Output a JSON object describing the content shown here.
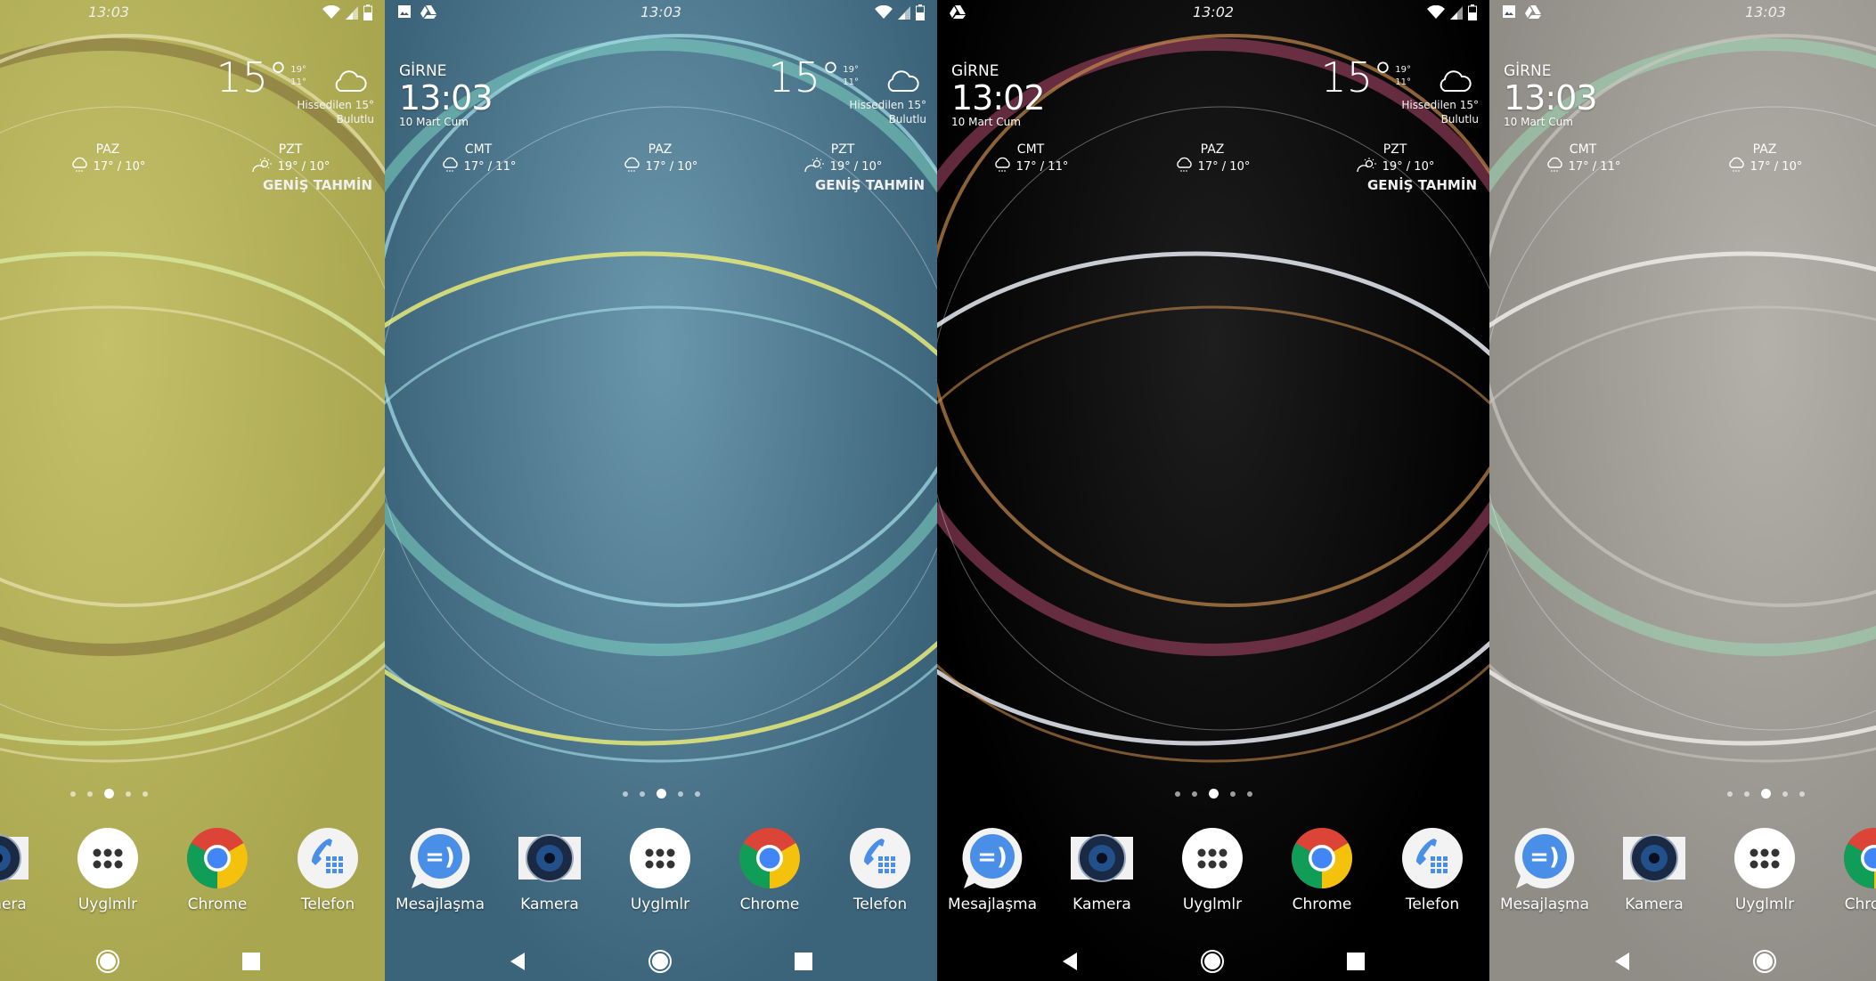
{
  "panels": [
    {
      "theme": {
        "bg1": "#a9a650",
        "bg2": "#c4c06a",
        "arc1": "#7d6a3a",
        "arc2": "#d6e59a",
        "arc3": "#e8e2b0"
      },
      "status_time": "13:03",
      "left_icons": [],
      "right_status": true,
      "clock": null,
      "active_page": 2
    },
    {
      "theme": {
        "bg1": "#3b6379",
        "bg2": "#6b97ad",
        "arc1": "#7fd6c4",
        "arc2": "#e8ea7a",
        "arc3": "#a6e3ea"
      },
      "status_time": "13:03",
      "left_icons": [
        "image-icon",
        "drive-icon"
      ],
      "right_status": true,
      "clock": {
        "city": "GİRNE",
        "time": "13:03",
        "date": "10 Mart Cum"
      },
      "active_page": 2
    },
    {
      "theme": {
        "bg1": "#000000",
        "bg2": "#1e1e1e",
        "arc1": "#b34a6d",
        "arc2": "#e8eef5",
        "arc3": "#c58a4a"
      },
      "status_time": "13:02",
      "left_icons": [
        "drive-icon"
      ],
      "right_status": true,
      "clock": {
        "city": "GİRNE",
        "time": "13:02",
        "date": "10 Mart Cum"
      },
      "active_page": 2
    },
    {
      "theme": {
        "bg1": "#8f8d86",
        "bg2": "#b3b1a9",
        "arc1": "#9fd9b5",
        "arc2": "#ecebe6",
        "arc3": "#c9c7bf"
      },
      "status_time": "13:03",
      "left_icons": [
        "image-icon",
        "drive-icon"
      ],
      "right_status": true,
      "clock": {
        "city": "GİRNE",
        "time": "13:03",
        "date": "10 Mart Cum"
      },
      "active_page": 2
    }
  ],
  "weather": {
    "current_temp": "15°",
    "high": "19°",
    "low": "11°",
    "condition_icon": "cloud-icon",
    "feels_like": "Hissedilen 15°",
    "condition": "Bulutlu",
    "forecast": [
      {
        "day": "CMT",
        "temps": "17° / 11°",
        "icon": "rain-cloud-icon"
      },
      {
        "day": "PAZ",
        "temps": "17° / 10°",
        "icon": "rain-cloud-icon"
      },
      {
        "day": "PZT",
        "temps": "19° / 10°",
        "icon": "partly-sunny-icon"
      }
    ],
    "extended_label": "GENİŞ TAHMİN"
  },
  "page_count": 5,
  "dock": [
    {
      "label": "Mesajlaşma",
      "icon": "messaging-icon"
    },
    {
      "label": "Kamera",
      "icon": "camera-icon"
    },
    {
      "label": "Uyglmlr",
      "icon": "app-drawer-icon"
    },
    {
      "label": "Chrome",
      "icon": "chrome-icon"
    },
    {
      "label": "Telefon",
      "icon": "phone-icon"
    }
  ],
  "nav": [
    "back-icon",
    "home-icon",
    "recents-icon"
  ]
}
